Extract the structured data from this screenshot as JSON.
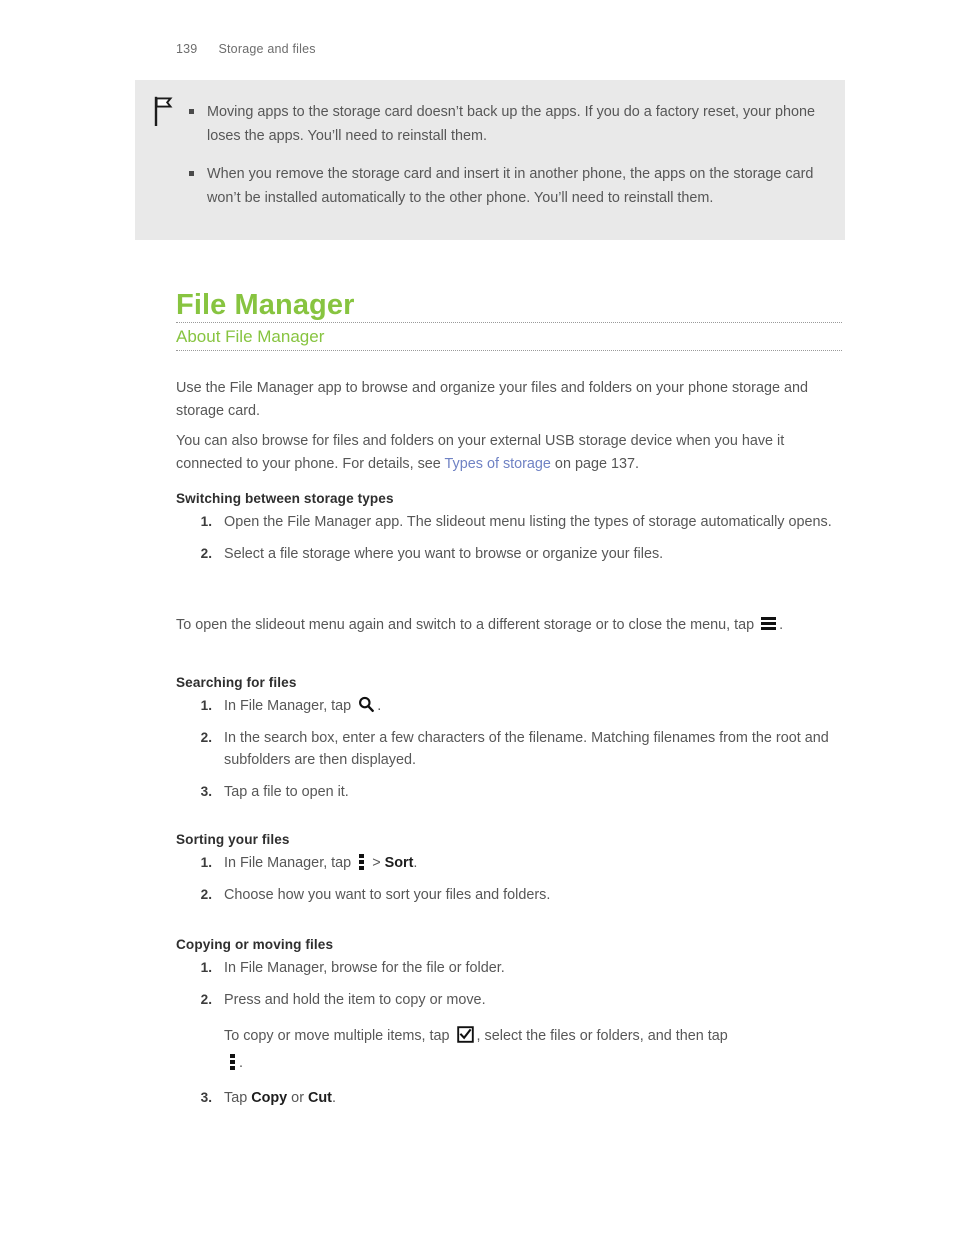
{
  "header": {
    "page_number": "139",
    "section": "Storage and files"
  },
  "note": {
    "icon": "flag-icon",
    "bullets": [
      "Moving apps to the storage card doesn’t back up the apps. If you do a factory reset, your phone loses the apps. You’ll need to reinstall them.",
      "When you remove the storage card and insert it in another phone, the apps on the storage card won’t be installed automatically to the other phone. You’ll need to reinstall them."
    ]
  },
  "chapter": {
    "title": "File Manager"
  },
  "section": {
    "heading": "About File Manager",
    "intro_paragraph": "Use the File Manager app to browse and organize your files and folders on your phone storage and storage card.",
    "second_paragraph_before_link": "You can also browse for files and folders on your external USB storage device when you have it connected to your phone. For details, see ",
    "link_text": "Types of storage",
    "second_paragraph_after_link": " on page 137."
  },
  "switching": {
    "heading": "Switching between storage types",
    "steps": [
      {
        "num": "1.",
        "text": "Open the File Manager app. The slideout menu listing the types of storage automatically opens."
      },
      {
        "num": "2.",
        "text": "Select a file storage where you want to browse or organize your files."
      }
    ],
    "closing_before_icon": "To open the slideout menu again and switch to a different storage or to close the menu, tap ",
    "closing_icon": "hamburger-menu-icon",
    "closing_after_icon": "."
  },
  "searching": {
    "heading": "Searching for files",
    "step1_num": "1.",
    "step1_before_icon": "In File Manager, tap ",
    "step1_icon": "search-icon",
    "step1_after_icon": ".",
    "step2_num": "2.",
    "step2_text": "In the search box, enter a few characters of the filename. Matching filenames from the root and subfolders are then displayed.",
    "step3_num": "3.",
    "step3_text": "Tap a file to open it."
  },
  "sorting": {
    "heading": "Sorting your files",
    "step1_num": "1.",
    "step1_before_icon": "In File Manager, tap ",
    "step1_icon": "overflow-menu-icon",
    "step1_separator": " > ",
    "step1_bold": "Sort",
    "step1_after": ".",
    "step2_num": "2.",
    "step2_text": "Choose how you want to sort your files and folders."
  },
  "copying": {
    "heading": "Copying or moving files",
    "step1_num": "1.",
    "step1_text": "In File Manager, browse for the file or folder.",
    "step2_num": "2.",
    "step2_text": "Press and hold the item to copy or move.",
    "step2_sub_before_checkbox": "To copy or move multiple items, tap ",
    "step2_checkbox_icon": "checkbox-checked-icon",
    "step2_sub_middle": ", select the files or folders, and then tap ",
    "step2_kebab_icon": "overflow-menu-icon",
    "step2_sub_end": ".",
    "step3_num": "3.",
    "step3_before_copy": "Tap ",
    "step3_copy": "Copy",
    "step3_or": " or ",
    "step3_cut": "Cut",
    "step3_end": "."
  },
  "colors": {
    "brand_green": "#87c440",
    "link_blue": "#6f82c4",
    "note_background": "#e9e9e9",
    "body_text": "#575757"
  }
}
